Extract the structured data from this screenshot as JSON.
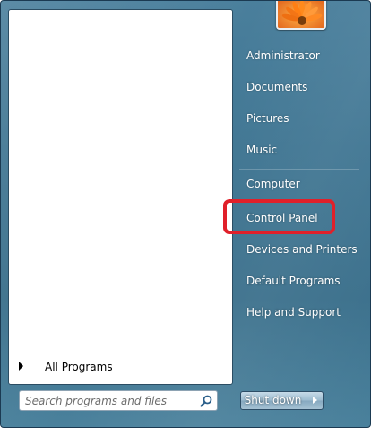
{
  "left_pane": {
    "all_programs_label": "All Programs",
    "search": {
      "placeholder": "Search programs and files",
      "value": "",
      "icon": "search-icon"
    }
  },
  "user_picture": {
    "icon": "flower-user-picture"
  },
  "right_pane": {
    "items": [
      {
        "label": "Administrator"
      },
      {
        "label": "Documents"
      },
      {
        "label": "Pictures"
      },
      {
        "label": "Music"
      },
      {
        "label": "Computer"
      },
      {
        "label": "Control Panel"
      },
      {
        "label": "Devices and Printers"
      },
      {
        "label": "Default Programs"
      },
      {
        "label": "Help and Support"
      }
    ],
    "highlighted_item": "Control Panel",
    "highlight_color": "#e0202a"
  },
  "shutdown": {
    "label": "Shut down",
    "arrow_icon": "chevron-right-icon"
  },
  "colors": {
    "menu_background": "#3f7592",
    "left_pane_background": "#ffffff",
    "right_text": "#ffffff"
  }
}
